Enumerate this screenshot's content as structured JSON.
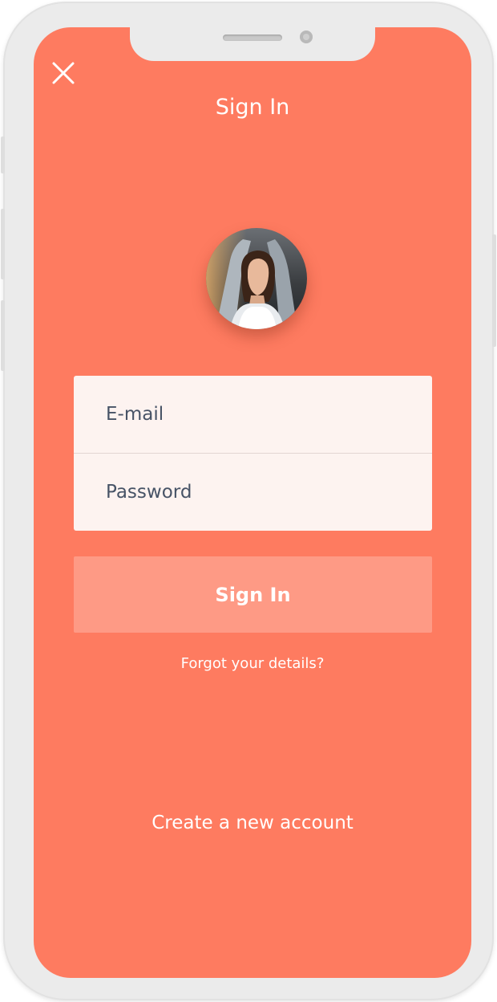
{
  "header": {
    "title": "Sign In",
    "close_icon": "close-icon"
  },
  "profile": {
    "avatar": "user-avatar-photo"
  },
  "form": {
    "email_placeholder": "E-mail",
    "password_placeholder": "Password",
    "submit_label": "Sign In"
  },
  "links": {
    "forgot": "Forgot your details?",
    "create_account": "Create a new account"
  },
  "colors": {
    "background": "#fe7b60",
    "button": "#fe9a85",
    "field_card": "#fdf3f0",
    "text": "#ffffff"
  }
}
